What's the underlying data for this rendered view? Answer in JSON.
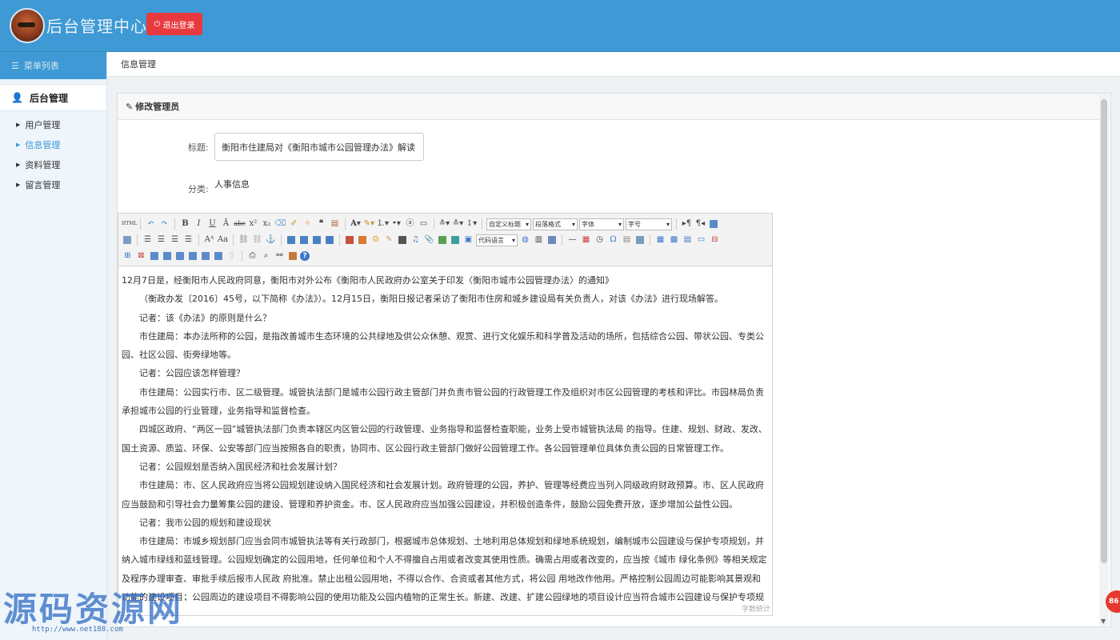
{
  "header": {
    "title": "后台管理中心",
    "logout_label": "退出登录"
  },
  "sidebar": {
    "menu_title": "菜单列表",
    "group_title": "后台管理",
    "items": [
      {
        "label": "用户管理",
        "active": false
      },
      {
        "label": "信息管理",
        "active": true
      },
      {
        "label": "资料管理",
        "active": false
      },
      {
        "label": "留言管理",
        "active": false
      }
    ]
  },
  "breadcrumb": "信息管理",
  "panel": {
    "title": "修改管理员"
  },
  "form": {
    "title_label": "标题:",
    "title_value": "衡阳市住建局对《衡阳市城市公园管理办法》解读",
    "category_label": "分类:",
    "category_value": "人事信息"
  },
  "editor": {
    "toolbar": {
      "html_label": "HTML",
      "heading_select": "自定义标题",
      "paragraph_select": "段落格式",
      "font_select": "字体",
      "size_select": "字号",
      "code_select": "代码语言"
    },
    "paragraphs": [
      "12月7日是，经衡阳市人民政府同意，衡阳市对外公布《衡阳市人民政府办公室关于印发〈衡阳市城市公园管理办法〉的通知》",
      "（衡政办发〔2016〕45号，以下简称《办法》）。12月15日，衡阳日报记者采访了衡阳市住房和城乡建设局有关负责人，对该《办法》进行现场解答。",
      "记者：该《办法》的原则是什么？",
      "市住建局：本办法所称的公园，是指改善城市生态环境的公共绿地及供公众休憩、观赏、进行文化娱乐和科学普及活动的场所，包括综合公园、带状公园、专类公园、社区公园、街旁绿地等。",
      "记者：公园应该怎样管理？",
      "市住建局：公园实行市、区二级管理。城管执法部门是城市公园行政主管部门并负责市管公园的行政管理工作及组织对市区公园管理的考核和评比。市园林局负责承担城市公园的行业管理，业务指导和监督检查。",
      "四城区政府、“两区一园”城管执法部门负责本辖区内区管公园的行政管理、业务指导和监督检查职能，业务上受市城管执法局 的指导。住建、规划、财政、发改、国土资源、质监、环保、公安等部门应当按照各自的职责，协同市、区公园行政主管部门做好公园管理工作。各公园管理单位具体负责公园的日常管理工作。",
      "记者：公园规划是否纳入国民经济和社会发展计划？",
      "市住建局：市、区人民政府应当将公园规划建设纳入国民经济和社会发展计划。政府管理的公园，养护、管理等经费应当列入同级政府财政预算。市、区人民政府应当鼓励和引导社会力量筹集公园的建设、管理和养护资金。市、区人民政府应当加强公园建设，并积极创造条件，鼓励公园免费开放，逐步增加公益性公园。",
      "记者：我市公园的规划和建设现状",
      "市住建局：市城乡规划部门应当会同市城管执法等有关行政部门，根据城市总体规划、土地利用总体规划和绿地系统规划，编制城市公园建设与保护专项规划，并纳入城市绿线和蓝线管理。公园规划确定的公园用地，任何单位和个人不得擅自占用或者改变其使用性质。确需占用或者改变的，应当按《城市 绿化条例》等相关规定及程序办理审查、审批手续后报市人民政 府批准。禁止出租公园用地，不得以合作、合资或者其他方式，将公园 用地改作他用。严格控制公园周边可能影响其景观和功能的建设项目；公园周边的建设项目不得影响公园的使用功能及公园内植物的正常生长。新建、改建、扩建公园绿地的项目设计应当符合城市公园建设与保护专项规划及有关设计规范、设计、施工应"
    ],
    "word_count_label": "字数统计"
  },
  "feedback_badge": "86",
  "watermark": {
    "text": "源码资源网",
    "url": "http://www.net188.com"
  }
}
